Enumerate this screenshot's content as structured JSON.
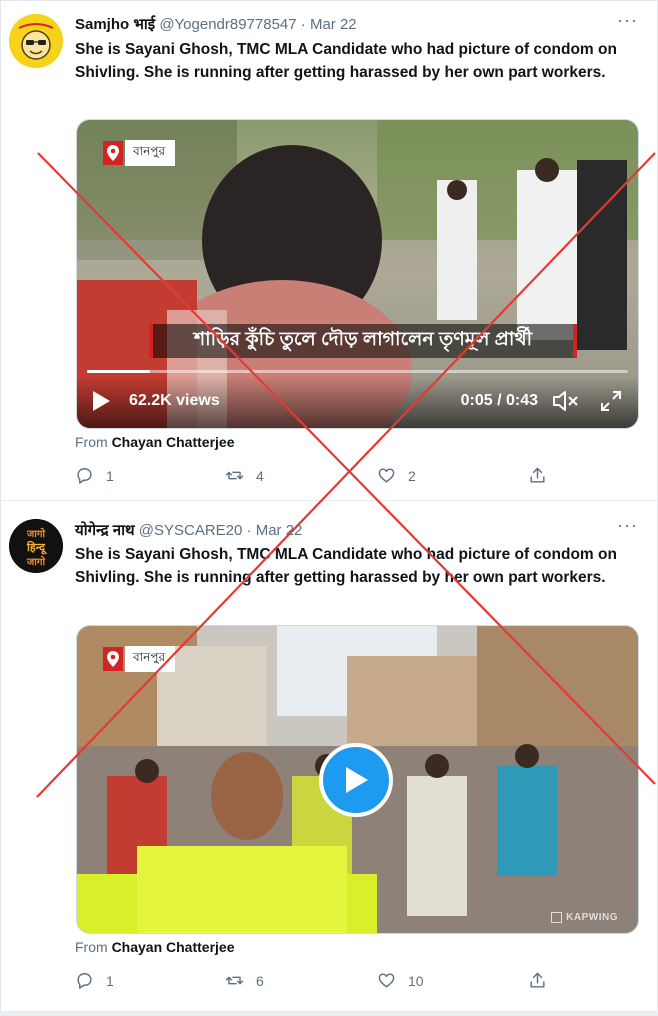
{
  "tweets": [
    {
      "author": "Samjho भाई",
      "handle": "@Yogendr89778547",
      "separator": "·",
      "date": "Mar 22",
      "more": "···",
      "text": "She is Sayani Ghosh, TMC MLA Candidate who had picture of condom on Shivling. She is running after getting harassed by her own part workers.",
      "media": {
        "location_tag": "বানপুর",
        "caption": "শাড়ির কুঁচি তুলে দৌড় লাগালেন তৃণমূল প্রার্থী",
        "views": "62.2K views",
        "time": "0:05 / 0:43",
        "progress": 0.116
      },
      "from_prefix": "From",
      "from_name": "Chayan Chatterjee",
      "replies": "1",
      "retweets": "4",
      "likes": "2"
    },
    {
      "author": "योगेन्द्र नाथ",
      "handle": "@SYSCARE20",
      "separator": "·",
      "date": "Mar 22",
      "more": "···",
      "avatar_text": [
        "जागो",
        "हिन्दू",
        "जागो"
      ],
      "text": "She is Sayani Ghosh, TMC MLA Candidate who had picture of condom on Shivling. She is running after getting harassed by her own part workers.",
      "media": {
        "location_tag": "বানপুর",
        "watermark": "KAPWING"
      },
      "from_prefix": "From",
      "from_name": "Chayan Chatterjee",
      "replies": "1",
      "retweets": "6",
      "likes": "10"
    }
  ],
  "colors": {
    "accent": "#1d9bf0",
    "cross": "#e53935",
    "secondary_text": "#5b7083"
  },
  "icons": [
    "reply-icon",
    "retweet-icon",
    "like-icon",
    "share-icon",
    "play-icon",
    "mute-icon",
    "fullscreen-icon",
    "location-pin-icon"
  ]
}
